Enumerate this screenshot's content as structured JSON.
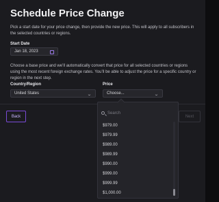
{
  "title": "Schedule Price Change",
  "description": "Pick a start date for your price change, then provide the new price. This will apply to all subscribers in the selected countries or regions.",
  "start_date": {
    "label": "Start Date",
    "value": "Jan 18, 2023"
  },
  "conversion_note": "Choose a base price and we’ll automatically convert that price for all selected countries or regions using the most recent foreign exchange rates. You’ll be able to adjust the price for a specific country or region in the next step.",
  "country": {
    "label": "Country/Region",
    "value": "United States"
  },
  "price": {
    "label": "Price",
    "placeholder": "Choose..."
  },
  "buttons": {
    "back": "Back",
    "next": "Next"
  },
  "dropdown": {
    "search_placeholder": "Search",
    "options": [
      "$979.00",
      "$979.99",
      "$989.00",
      "$989.99",
      "$990.00",
      "$999.00",
      "$999.99",
      "$1,000.00"
    ]
  },
  "colors": {
    "accent": "#7b4bd8",
    "background": "#1b1b1f"
  }
}
